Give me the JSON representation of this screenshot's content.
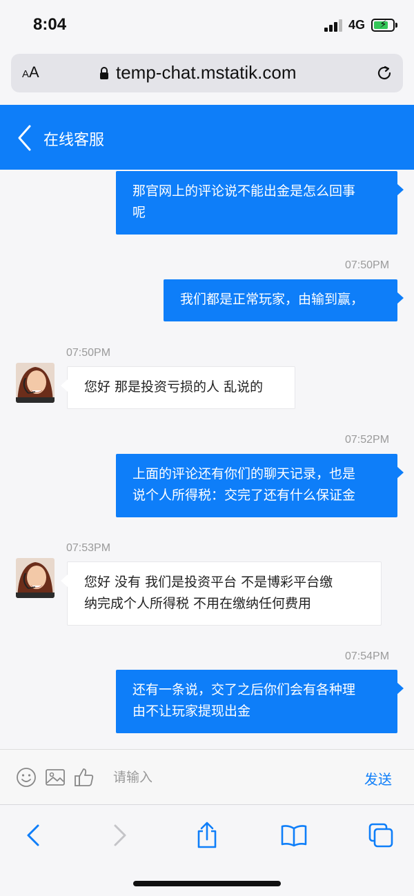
{
  "status_bar": {
    "time": "8:04",
    "network": "4G"
  },
  "browser": {
    "text_size_label": "AA",
    "url": "temp-chat.mstatik.com"
  },
  "header": {
    "title": "在线客服"
  },
  "messages": [
    {
      "side": "out",
      "timestamp": "",
      "lines": [
        "那官网上的评论说不能出金是怎么回事",
        "呢"
      ]
    },
    {
      "side": "out",
      "timestamp": "07:50PM",
      "lines": [
        "我们都是正常玩家，由输到赢，"
      ]
    },
    {
      "side": "in",
      "timestamp": "07:50PM",
      "lines": [
        "您好 那是投资亏损的人 乱说的"
      ]
    },
    {
      "side": "out",
      "timestamp": "07:52PM",
      "lines": [
        "上面的评论还有你们的聊天记录，也是",
        "说个人所得税：交完了还有什么保证金"
      ]
    },
    {
      "side": "in",
      "timestamp": "07:53PM",
      "lines": [
        "您好 没有 我们是投资平台 不是博彩平台缴",
        "纳完成个人所得税 不用在缴纳任何费用"
      ]
    },
    {
      "side": "out",
      "timestamp": "07:54PM",
      "lines": [
        "还有一条说，交了之后你们会有各种理",
        "由不让玩家提现出金"
      ]
    }
  ],
  "input_bar": {
    "placeholder": "请输入",
    "send_label": "发送"
  },
  "colors": {
    "accent": "#0e7ef9",
    "battery": "#35c759"
  }
}
